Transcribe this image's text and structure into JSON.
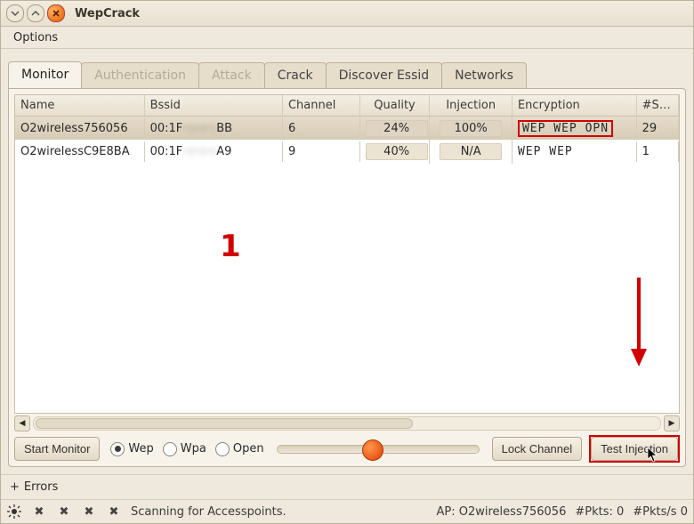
{
  "window": {
    "title": "WepCrack"
  },
  "menu": {
    "options": "Options"
  },
  "tabs": [
    {
      "id": "monitor",
      "label": "Monitor",
      "active": true
    },
    {
      "id": "auth",
      "label": "Authentication",
      "disabled": true
    },
    {
      "id": "attack",
      "label": "Attack",
      "disabled": true
    },
    {
      "id": "crack",
      "label": "Crack"
    },
    {
      "id": "discover",
      "label": "Discover Essid"
    },
    {
      "id": "networks",
      "label": "Networks"
    }
  ],
  "table": {
    "headers": {
      "name": "Name",
      "bssid": "Bssid",
      "channel": "Channel",
      "quality": "Quality",
      "injection": "Injection",
      "encryption": "Encryption",
      "stat": "#Stat"
    },
    "rows": [
      {
        "name": "O2wireless756056",
        "bssid_prefix": "00:1F",
        "bssid_hidden": "··:··:··:",
        "bssid_suffix": "BB",
        "channel": "6",
        "quality": "24%",
        "injection": "100%",
        "encryption": "WEP WEP  OPN",
        "stat": "29",
        "selected": true,
        "enc_highlight": true
      },
      {
        "name": "O2wirelessC9E8BA",
        "bssid_prefix": "00:1F",
        "bssid_hidden": "··:··:··:",
        "bssid_suffix": "A9",
        "channel": "9",
        "quality": "40%",
        "injection": "N/A",
        "encryption": "WEP WEP",
        "stat": "1",
        "selected": false,
        "enc_highlight": false
      }
    ]
  },
  "toolbar": {
    "start_monitor": "Start Monitor",
    "radios": {
      "wep": "Wep",
      "wpa": "Wpa",
      "open": "Open",
      "selected": "wep"
    },
    "lock_channel": "Lock Channel",
    "test_injection": "Test Injection"
  },
  "expander": {
    "errors": "Errors",
    "symbol": "+"
  },
  "statusbar": {
    "scanning": "Scanning for Accesspoints.",
    "ap_label": "AP:",
    "ap_value": "O2wireless756056",
    "pkts_label": "#Pkts:",
    "pkts_value": "0",
    "pkts_s_label": "#Pkts/s",
    "pkts_s_value": "0"
  },
  "annotations": {
    "label1": "1"
  }
}
